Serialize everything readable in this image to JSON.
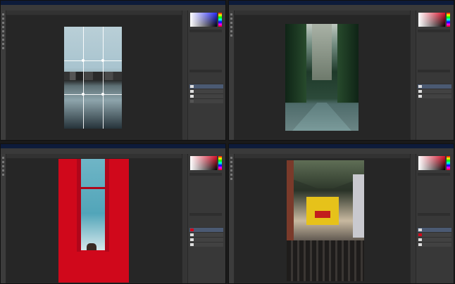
{
  "accent_colors": {
    "menubar": "#0d1b3a",
    "panel": "#383838",
    "canvas_bg": "#262626",
    "selected_layer": "#4b5a73"
  },
  "panes": [
    {
      "name": "city-skyline-grid",
      "icons": [
        "move-tool-icon",
        "marquee-tool-icon",
        "lasso-tool-icon",
        "crop-tool-icon",
        "brush-tool-icon",
        "eraser-tool-icon",
        "text-tool-icon",
        "hand-tool-icon",
        "zoom-tool-icon"
      ]
    },
    {
      "name": "forest-road"
    },
    {
      "name": "red-window-frame"
    },
    {
      "name": "city-street-crowd"
    }
  ]
}
